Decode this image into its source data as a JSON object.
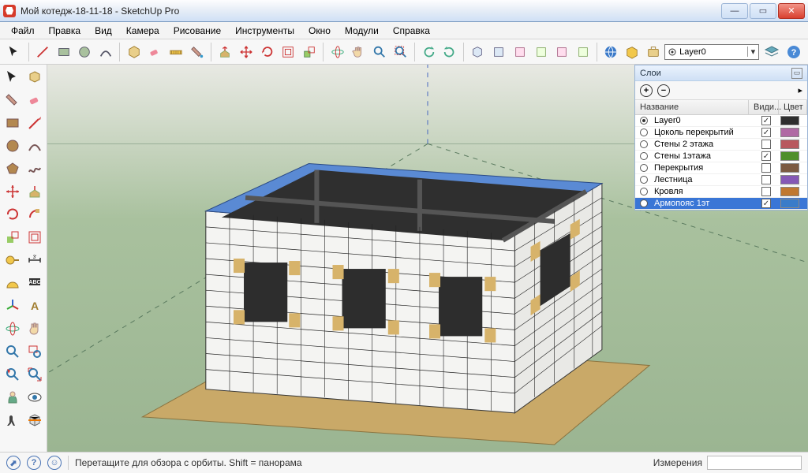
{
  "window": {
    "title": "Мой котедж-18-11-18 - SketchUp Pro"
  },
  "menu": [
    "Файл",
    "Правка",
    "Вид",
    "Камера",
    "Рисование",
    "Инструменты",
    "Окно",
    "Модули",
    "Справка"
  ],
  "layer_selector": {
    "value": "Layer0"
  },
  "layers_panel": {
    "title": "Слои",
    "columns": [
      "Название",
      "Види...",
      "Цвет"
    ],
    "rows": [
      {
        "name": "Layer0",
        "active": true,
        "visible": true,
        "color": "#2e2e2e"
      },
      {
        "name": "Цоколь перекрытий",
        "active": false,
        "visible": true,
        "color": "#b06aa4"
      },
      {
        "name": "Стены 2 этажа",
        "active": false,
        "visible": false,
        "color": "#b8595f"
      },
      {
        "name": "Стены 1этажа",
        "active": false,
        "visible": true,
        "color": "#4f8f2a"
      },
      {
        "name": "Перекрытия",
        "active": false,
        "visible": false,
        "color": "#7b5a42"
      },
      {
        "name": "Лестница",
        "active": false,
        "visible": false,
        "color": "#8558b5"
      },
      {
        "name": "Кровля",
        "active": false,
        "visible": false,
        "color": "#c07830"
      },
      {
        "name": "Армопояс 1эт",
        "active": false,
        "visible": true,
        "color": "#3a7cc9",
        "selected": true
      }
    ]
  },
  "status": {
    "hint": "Перетащите для обзора с орбиты. Shift = панорама",
    "measure_label": "Измерения"
  },
  "toolbar_icons": [
    "cursor",
    "rect",
    "circle",
    "line",
    "arc",
    "eraser",
    "tape",
    "protractor",
    "text",
    "paint",
    "push",
    "move",
    "rotate",
    "scale",
    "offset",
    "orbit",
    "pan",
    "zoom",
    "zoom-extents",
    "prev",
    "next",
    "iso",
    "front",
    "section",
    "walk",
    "look",
    "position"
  ],
  "left_icons": [
    "select",
    "eraser2",
    "paint2",
    "pencil",
    "rect2",
    "circle2",
    "poly",
    "arc2",
    "move2",
    "push2",
    "rotate2",
    "follow",
    "scale2",
    "offset2",
    "tape2",
    "prot2",
    "dim",
    "text2",
    "axes",
    "3dtext",
    "orbit2",
    "pan2",
    "zoom2",
    "zoomwin",
    "prev2",
    "zoomext",
    "position2",
    "look2",
    "walk2",
    "section2"
  ]
}
